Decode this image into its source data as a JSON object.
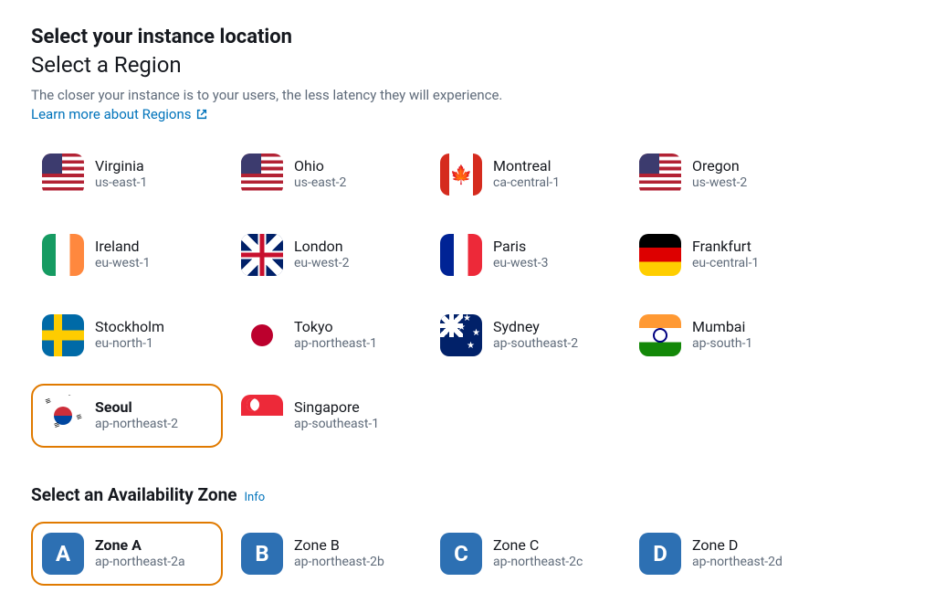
{
  "heading": "Select your instance location",
  "subheading": "Select a Region",
  "description": "The closer your instance is to your users, the less latency they will experience.",
  "learn_more": "Learn more about Regions",
  "regions": [
    {
      "name": "Virginia",
      "code": "us-east-1",
      "flag": "flag-us",
      "selected": false
    },
    {
      "name": "Ohio",
      "code": "us-east-2",
      "flag": "flag-us",
      "selected": false
    },
    {
      "name": "Montreal",
      "code": "ca-central-1",
      "flag": "flag-ca",
      "selected": false
    },
    {
      "name": "Oregon",
      "code": "us-west-2",
      "flag": "flag-us",
      "selected": false
    },
    {
      "name": "Ireland",
      "code": "eu-west-1",
      "flag": "flag-ie",
      "selected": false
    },
    {
      "name": "London",
      "code": "eu-west-2",
      "flag": "flag-uk",
      "selected": false
    },
    {
      "name": "Paris",
      "code": "eu-west-3",
      "flag": "flag-fr",
      "selected": false
    },
    {
      "name": "Frankfurt",
      "code": "eu-central-1",
      "flag": "flag-de",
      "selected": false
    },
    {
      "name": "Stockholm",
      "code": "eu-north-1",
      "flag": "flag-se",
      "selected": false
    },
    {
      "name": "Tokyo",
      "code": "ap-northeast-1",
      "flag": "flag-jp",
      "selected": false
    },
    {
      "name": "Sydney",
      "code": "ap-southeast-2",
      "flag": "flag-au",
      "selected": false
    },
    {
      "name": "Mumbai",
      "code": "ap-south-1",
      "flag": "flag-in",
      "selected": false
    },
    {
      "name": "Seoul",
      "code": "ap-northeast-2",
      "flag": "flag-kr",
      "selected": true
    },
    {
      "name": "Singapore",
      "code": "ap-southeast-1",
      "flag": "flag-sg",
      "selected": false
    }
  ],
  "az_heading": "Select an Availability Zone",
  "az_info": "Info",
  "zones": [
    {
      "letter": "A",
      "name": "Zone A",
      "code": "ap-northeast-2a",
      "selected": true
    },
    {
      "letter": "B",
      "name": "Zone B",
      "code": "ap-northeast-2b",
      "selected": false
    },
    {
      "letter": "C",
      "name": "Zone C",
      "code": "ap-northeast-2c",
      "selected": false
    },
    {
      "letter": "D",
      "name": "Zone D",
      "code": "ap-northeast-2d",
      "selected": false
    }
  ]
}
